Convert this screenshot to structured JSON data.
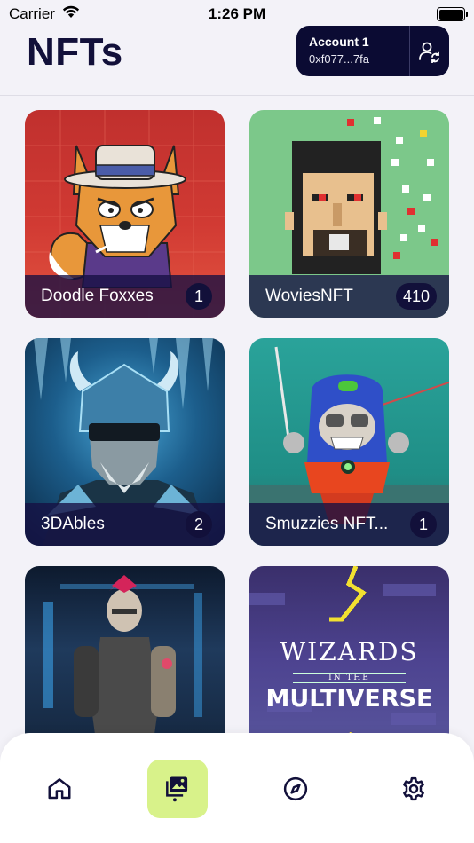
{
  "status_bar": {
    "carrier": "Carrier",
    "time": "1:26 PM"
  },
  "header": {
    "title": "NFTs",
    "account": {
      "name": "Account 1",
      "address": "0xf077...7fa"
    }
  },
  "collections": [
    {
      "name": "Doodle Foxxes",
      "count": "1"
    },
    {
      "name": "WoviesNFT",
      "count": "410"
    },
    {
      "name": "3DAbles",
      "count": "2"
    },
    {
      "name": "Smuzzies NFT...",
      "count": "1"
    },
    {
      "name": "",
      "count": ""
    },
    {
      "name": "",
      "count": ""
    }
  ],
  "art_text": {
    "wizards_line1": "WIZARDS",
    "wizards_line2": "IN THE",
    "wizards_line3": "MULTIVERSE"
  },
  "tab_bar": {
    "tabs": [
      {
        "name": "home",
        "icon": "home-icon"
      },
      {
        "name": "nfts",
        "icon": "nft-gallery-icon",
        "active": true
      },
      {
        "name": "explore",
        "icon": "compass-icon"
      },
      {
        "name": "settings",
        "icon": "gear-icon"
      }
    ]
  },
  "colors": {
    "background": "#f3f2f8",
    "navy": "#0b0b33",
    "accent": "#d8f28a"
  }
}
